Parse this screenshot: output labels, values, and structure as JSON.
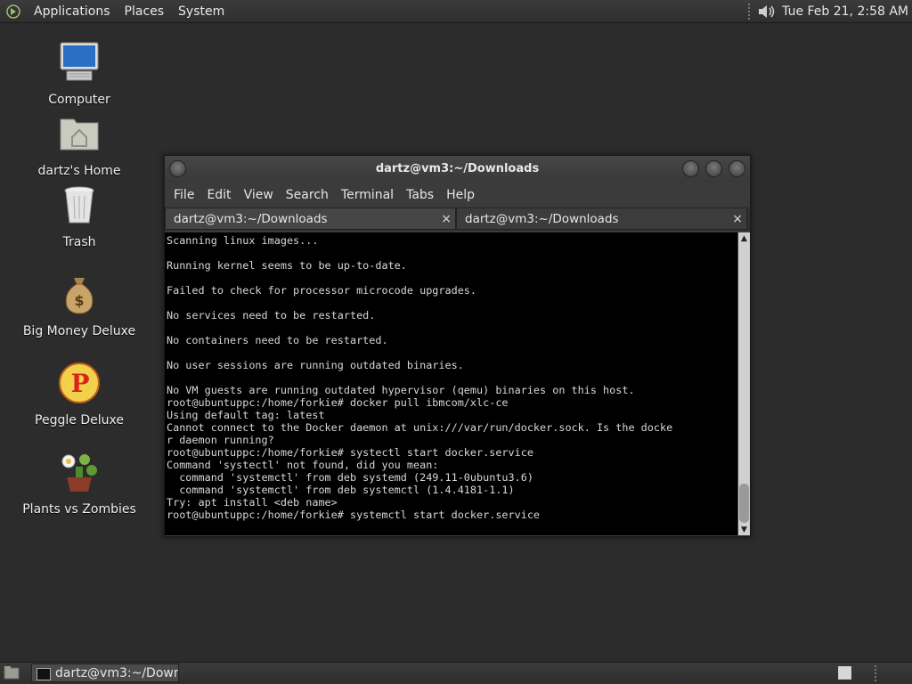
{
  "top_panel": {
    "menus": [
      "Applications",
      "Places",
      "System"
    ],
    "clock": "Tue Feb 21,  2:58 AM"
  },
  "desktop_icons": [
    {
      "label": "Computer",
      "icon": "computer-icon"
    },
    {
      "label": "dartz's Home",
      "icon": "home-folder-icon"
    },
    {
      "label": "Trash",
      "icon": "trash-icon"
    },
    {
      "label": "Big Money Deluxe",
      "icon": "money-bag-icon"
    },
    {
      "label": "Peggle Deluxe",
      "icon": "peggle-icon"
    },
    {
      "label": "Plants vs Zombies",
      "icon": "plants-vs-zombies-icon"
    }
  ],
  "terminal": {
    "title": "dartz@vm3:~/Downloads",
    "menus": [
      "File",
      "Edit",
      "View",
      "Search",
      "Terminal",
      "Tabs",
      "Help"
    ],
    "tabs": [
      {
        "label": "dartz@vm3:~/Downloads",
        "close": "×"
      },
      {
        "label": "dartz@vm3:~/Downloads",
        "close": "×"
      }
    ],
    "output": "Scanning linux images...\n\nRunning kernel seems to be up-to-date.\n\nFailed to check for processor microcode upgrades.\n\nNo services need to be restarted.\n\nNo containers need to be restarted.\n\nNo user sessions are running outdated binaries.\n\nNo VM guests are running outdated hypervisor (qemu) binaries on this host.\nroot@ubuntuppc:/home/forkie# docker pull ibmcom/xlc-ce\nUsing default tag: latest\nCannot connect to the Docker daemon at unix:///var/run/docker.sock. Is the docke\nr daemon running?\nroot@ubuntuppc:/home/forkie# systectl start docker.service\nCommand 'systectl' not found, did you mean:\n  command 'systemctl' from deb systemd (249.11-0ubuntu3.6)\n  command 'systemctl' from deb systemctl (1.4.4181-1.1)\nTry: apt install <deb name>\nroot@ubuntuppc:/home/forkie# systemctl start docker.service"
  },
  "taskbar": {
    "window_button": "dartz@vm3:~/Down..."
  }
}
